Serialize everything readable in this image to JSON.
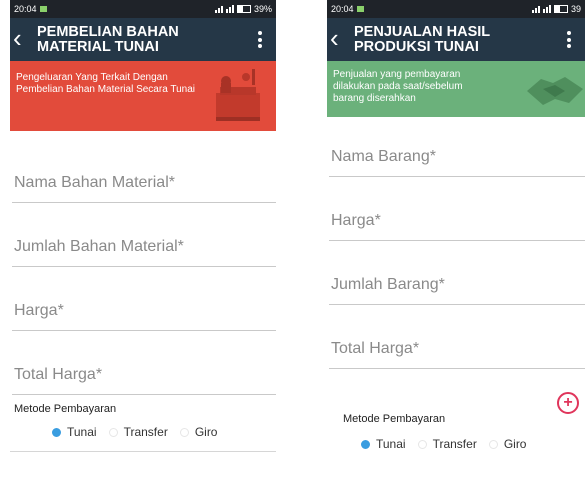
{
  "left": {
    "status": {
      "time": "20:04",
      "battery": "39%"
    },
    "appbar": {
      "title_line1": "PEMBELIAN  BAHAN",
      "title_line2": "MATERIAL TUNAI"
    },
    "banner": {
      "text": "Pengeluaran Yang Terkait Dengan Pembelian Bahan Material Secara Tunai",
      "color": "#e24b3b"
    },
    "fields": [
      {
        "placeholder": "Nama Bahan Material*"
      },
      {
        "placeholder": "Jumlah Bahan Material*"
      },
      {
        "placeholder": "Harga*"
      },
      {
        "placeholder": "Total Harga*"
      }
    ],
    "payment": {
      "label": "Metode Pembayaran",
      "options": [
        "Tunai",
        "Transfer",
        "Giro"
      ],
      "selected": "Tunai"
    }
  },
  "right": {
    "status": {
      "time": "20:04",
      "battery": "39"
    },
    "appbar": {
      "title_line1": "PENJUALAN HASIL",
      "title_line2": "PRODUKSI TUNAI"
    },
    "banner": {
      "text": "Penjualan yang pembayaran dilakukan pada saat/sebelum barang diserahkan",
      "color": "#6bb17b"
    },
    "fields": [
      {
        "placeholder": "Nama Barang*"
      },
      {
        "placeholder": "Harga*"
      },
      {
        "placeholder": "Jumlah Barang*"
      },
      {
        "placeholder": "Total Harga*"
      }
    ],
    "payment": {
      "label": "Metode Pembayaran",
      "options": [
        "Tunai",
        "Transfer",
        "Giro"
      ],
      "selected": "Tunai"
    }
  },
  "colors": {
    "appbar": "#253747",
    "accent_radio": "#3a9de0",
    "fab": "#e0355b"
  },
  "icons": {
    "back": "back-arrow-icon",
    "menu": "overflow-menu-icon",
    "add": "add-circle-icon"
  }
}
